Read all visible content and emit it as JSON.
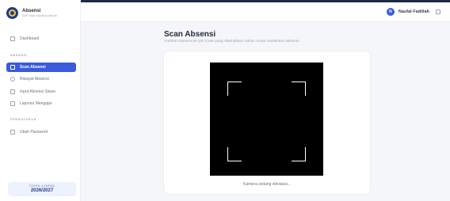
{
  "brand": {
    "name": "Absensi",
    "subtitle": "SMP Islam Nurulhud Wirnah"
  },
  "sidebar": {
    "items": [
      {
        "label": "Dashboard"
      },
      {
        "label": "Scan Absensi"
      },
      {
        "label": "Riwayat Absensi"
      },
      {
        "label": "Input Absensi Siswa"
      },
      {
        "label": "Laporan Mengajar"
      },
      {
        "label": "Ubah Password"
      }
    ],
    "sections": [
      "ABSENSI",
      "PENGATURAN"
    ],
    "year": {
      "label": "TAHUN AJARAN",
      "value": "2026/2027"
    }
  },
  "header": {
    "user_initial": "N",
    "user_name": "Naufal Fadillah"
  },
  "main": {
    "title": "Scan Absensi",
    "subtitle": "Arahkan kamera ke QR Code yang ditampilkan Admin untuk melakukan absensi.",
    "camera_status": "Kamera sedang diinisiasi..."
  },
  "colors": {
    "accent": "#3b5bdb",
    "brand": "#1f3a8a"
  },
  "icons": [
    "logo",
    "dashboard-icon",
    "scan-icon",
    "history-icon",
    "edit-icon",
    "report-icon",
    "lock-icon",
    "logout-icon"
  ]
}
